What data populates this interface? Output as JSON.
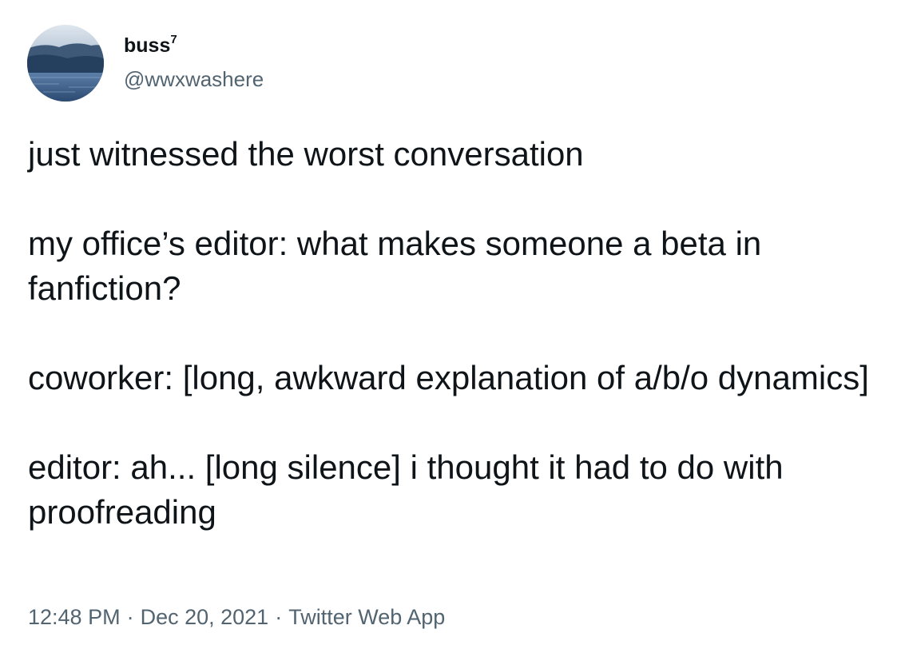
{
  "author": {
    "display_name": "buss",
    "display_name_superscript": "7",
    "handle": "@wwxwashere",
    "avatar_icon": "landscape-photo-avatar"
  },
  "tweet": {
    "paragraphs": [
      "just witnessed the worst conversation",
      "my office’s editor: what makes someone a beta in fanfiction?",
      "coworker: [long, awkward explanation of a/b/o dynamics]",
      "editor: ah... [long silence] i thought it had to do with proofreading"
    ]
  },
  "meta": {
    "time": "12:48 PM",
    "separator": "·",
    "date": "Dec 20, 2021",
    "source": "Twitter Web App"
  },
  "colors": {
    "text_primary": "#0f1419",
    "text_secondary": "#536471",
    "background": "#ffffff"
  }
}
